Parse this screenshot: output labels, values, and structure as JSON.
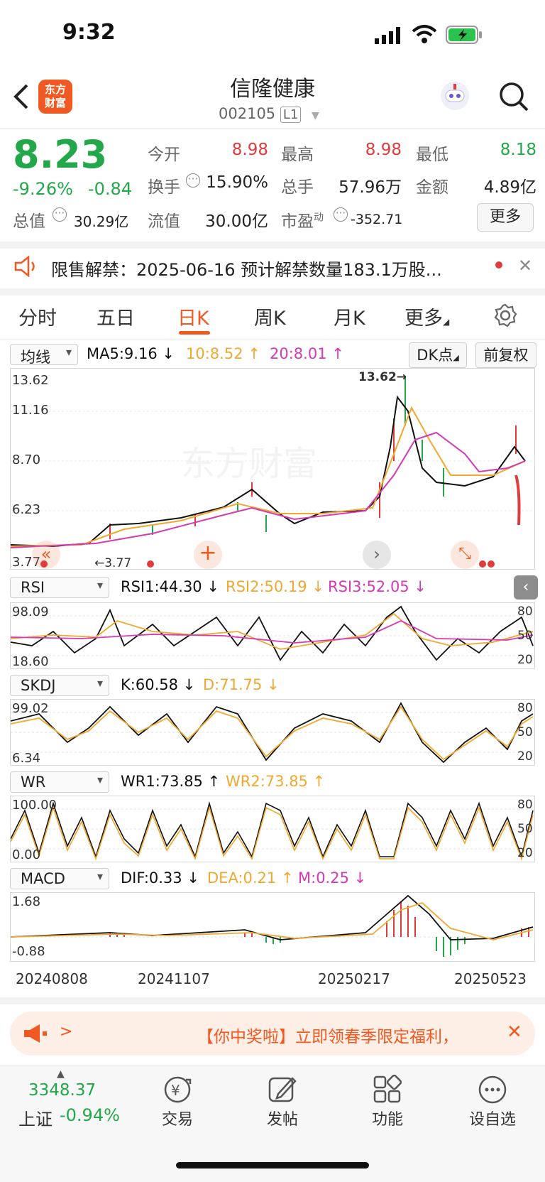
{
  "status": {
    "time": "9:32"
  },
  "header": {
    "name": "信隆健康",
    "code": "002105",
    "level": "L1",
    "logo_text": "东方财富"
  },
  "quote": {
    "price": "8.23",
    "pct": "-9.26%",
    "chg": "-0.84",
    "open_label": "今开",
    "open": "8.98",
    "high_label": "最高",
    "high": "8.98",
    "low_label": "最低",
    "low": "8.18",
    "turnover_label": "换手",
    "turnover": "15.90%",
    "volume_label": "总手",
    "volume": "57.96万",
    "amount_label": "金额",
    "amount": "4.89亿",
    "mktcap_label": "总值",
    "mktcap": "30.29亿",
    "float_label": "流值",
    "float": "30.00亿",
    "pe_label": "市盈",
    "pe_sup": "动",
    "pe": "-352.71",
    "more": "更多"
  },
  "notice": {
    "text": "限售解禁：2025-06-16 预计解禁数量183.1万股..."
  },
  "tabs": [
    "分时",
    "五日",
    "日K",
    "周K",
    "月K",
    "更多"
  ],
  "active_tab": 2,
  "ma": {
    "select": "均线",
    "ma5": "MA5:9.16 ↓",
    "ma10": "10:8.52 ↑",
    "ma20": "20:8.01 ↑",
    "dk": "DK点",
    "adj": "前复权"
  },
  "main_chart": {
    "max": "13.62",
    "l2": "11.16",
    "l3": "8.70",
    "l4": "6.23",
    "min": "3.77",
    "peak": "13.62→",
    "low_mark": "←3.77",
    "watermark": "东方财富"
  },
  "rsi": {
    "select": "RSI",
    "r1": "RSI1:44.30 ↓",
    "r2": "RSI2:50.19 ↓",
    "r3": "RSI3:52.05 ↓",
    "top": "98.09",
    "bottom": "18.60",
    "r80": "80",
    "r50": "50",
    "r20": "20"
  },
  "skdj": {
    "select": "SKDJ",
    "k": "K:60.58 ↓",
    "d": "D:71.75 ↓",
    "top": "99.02",
    "bottom": "6.34",
    "r80": "80",
    "r50": "50",
    "r20": "20"
  },
  "wr": {
    "select": "WR",
    "w1": "WR1:73.85 ↑",
    "w2": "WR2:73.85 ↑",
    "top": "100.00",
    "bottom": "0.00",
    "r80": "80",
    "r50": "50",
    "r20": "20"
  },
  "macd": {
    "select": "MACD",
    "dif": "DIF:0.33 ↓",
    "dea": "DEA:0.21 ↑",
    "m": "M:0.25 ↓",
    "top": "1.68",
    "bottom": "-0.88"
  },
  "dates": [
    "20240808",
    "20241107",
    "20250217",
    "20250523"
  ],
  "banner": {
    "text": "【你中奖啦】立即领春季限定福利，"
  },
  "nav": {
    "index_value": "3348.37",
    "index_name": "上证",
    "index_pct": "-0.94%",
    "trade": "交易",
    "post": "发帖",
    "func": "功能",
    "watch": "设自选"
  },
  "colors": {
    "green": "#22a84a",
    "red": "#e23b3b",
    "orange": "#f0a830",
    "magenta": "#d63ab3",
    "accent": "#f05a22"
  }
}
